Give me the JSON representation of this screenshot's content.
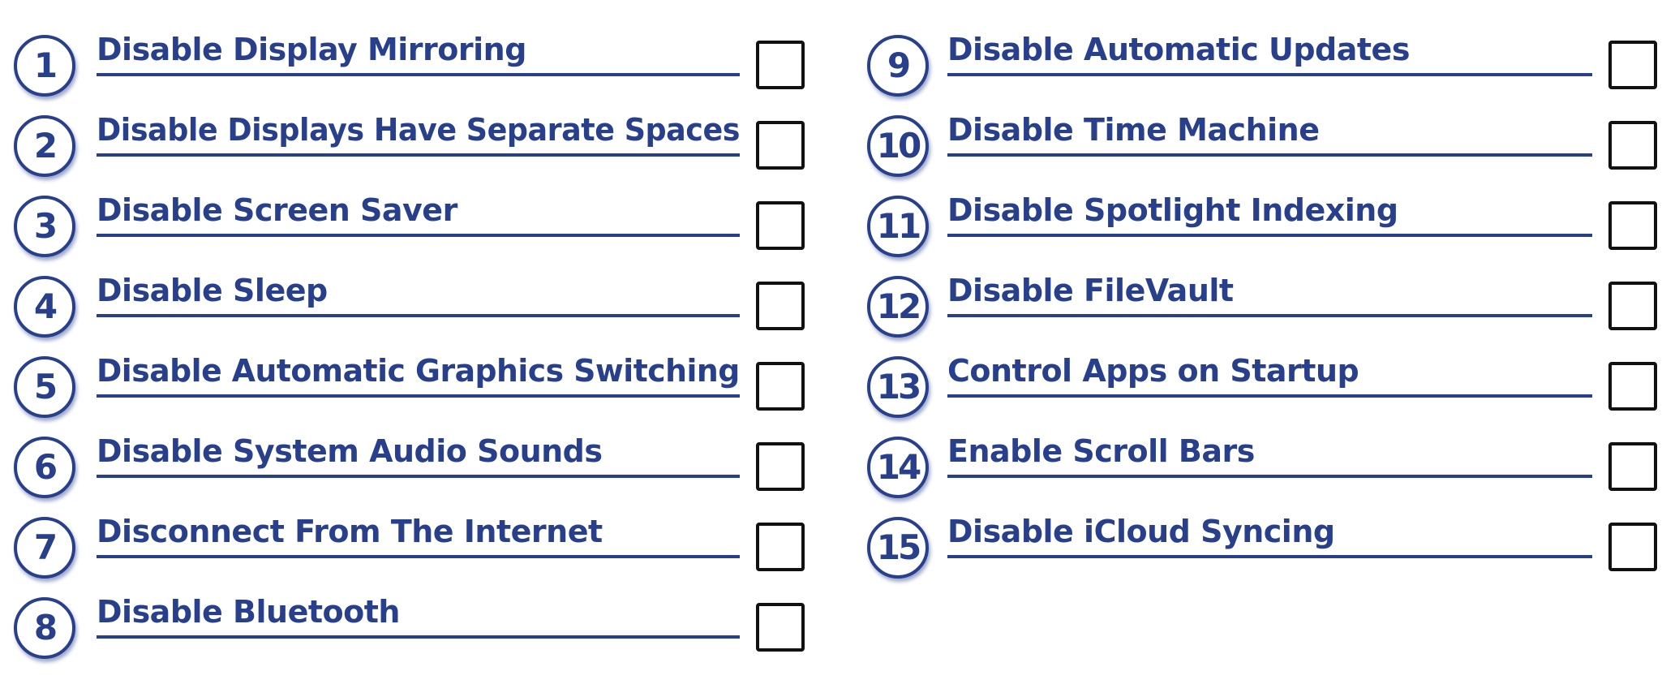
{
  "accent_color": "#283f8c",
  "items": [
    {
      "number": "1",
      "label": "Disable Display Mirroring",
      "checked": false
    },
    {
      "number": "2",
      "label": "Disable Displays Have Separate Spaces",
      "checked": false
    },
    {
      "number": "3",
      "label": "Disable Screen Saver",
      "checked": false
    },
    {
      "number": "4",
      "label": "Disable Sleep",
      "checked": false
    },
    {
      "number": "5",
      "label": "Disable Automatic Graphics Switching",
      "checked": false
    },
    {
      "number": "6",
      "label": "Disable System Audio Sounds",
      "checked": false
    },
    {
      "number": "7",
      "label": "Disconnect From The Internet",
      "checked": false
    },
    {
      "number": "8",
      "label": "Disable Bluetooth",
      "checked": false
    },
    {
      "number": "9",
      "label": "Disable Automatic Updates",
      "checked": false
    },
    {
      "number": "10",
      "label": "Disable Time Machine",
      "checked": false
    },
    {
      "number": "11",
      "label": "Disable Spotlight Indexing",
      "checked": false
    },
    {
      "number": "12",
      "label": "Disable FileVault",
      "checked": false
    },
    {
      "number": "13",
      "label": "Control Apps on Startup",
      "checked": false
    },
    {
      "number": "14",
      "label": "Enable Scroll Bars",
      "checked": false
    },
    {
      "number": "15",
      "label": "Disable iCloud Syncing",
      "checked": false
    }
  ]
}
